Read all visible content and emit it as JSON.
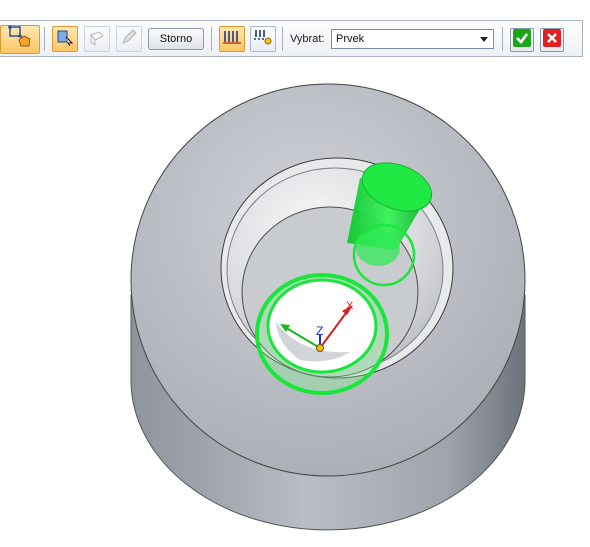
{
  "toolbar": {
    "cancel_label": "Storno",
    "select_label": "Vybrat:",
    "select_value": "Prvek"
  },
  "icons": {
    "step_icon": "solid-shape-icon",
    "body_select": "body-select-icon",
    "face_select": "face-select-icon",
    "pencil": "pencil-icon",
    "extent_finite": "finite-extent-icon",
    "extent_through": "through-all-extent-icon",
    "accept": "check-icon",
    "reject": "close-icon"
  },
  "colors": {
    "active_tool": "#ffc766",
    "accept_green": "#1aa51a",
    "reject_red": "#e32020",
    "highlight": "#19e63a",
    "part_gray": "#b8bcc3"
  }
}
